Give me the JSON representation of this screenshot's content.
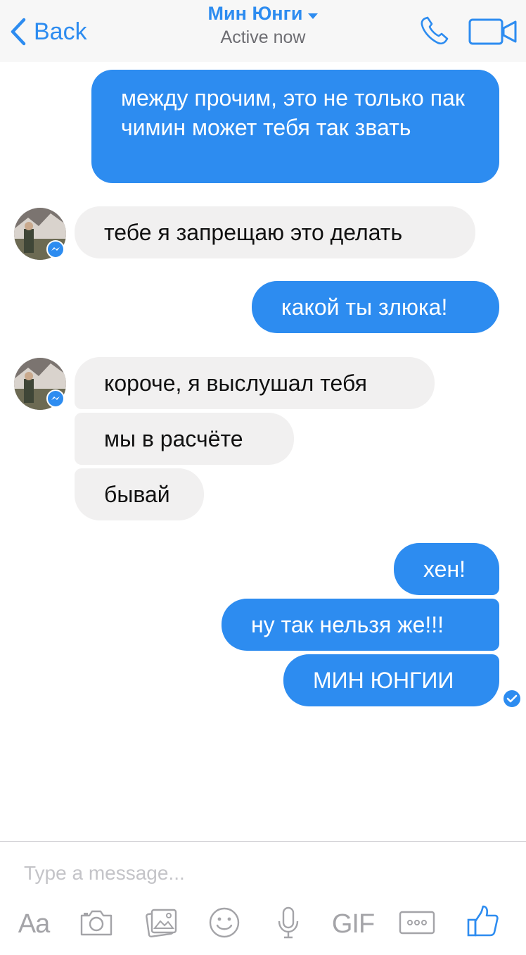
{
  "header": {
    "back_label": "Back",
    "contact_name": "Мин Юнги",
    "status": "Active now"
  },
  "messages": [
    {
      "direction": "outgoing",
      "text": "между прочим, это не только пак чимин может тебя так звать"
    },
    {
      "direction": "incoming",
      "text": "тебе я запрещаю это делать"
    },
    {
      "direction": "outgoing",
      "text": "какой ты злюка!"
    },
    {
      "direction": "incoming",
      "text": "короче, я выслушал тебя"
    },
    {
      "direction": "incoming",
      "text": "мы в расчёте"
    },
    {
      "direction": "incoming",
      "text": "бывай"
    },
    {
      "direction": "outgoing",
      "text": "хен!"
    },
    {
      "direction": "outgoing",
      "text": "ну так нельзя же!!!"
    },
    {
      "direction": "outgoing",
      "text": "МИН ЮНГИИ"
    }
  ],
  "composer": {
    "placeholder": "Type a message...",
    "text_tool_label": "Aa",
    "gif_label": "GIF"
  },
  "icons": {
    "header": [
      "chevron-left-icon",
      "caret-down-icon",
      "phone-icon",
      "video-camera-icon"
    ],
    "toolbar": [
      "camera-icon",
      "photo-gallery-icon",
      "emoji-icon",
      "microphone-icon",
      "more-options-icon",
      "thumbs-up-icon"
    ],
    "avatar_badge": "messenger-bolt-icon",
    "read_receipt": "checkmark-icon"
  },
  "colors": {
    "accent": "#2d8cf0",
    "incoming_bubble": "#f1f0f0",
    "toolbar_icon": "#a4a4a8",
    "header_bg": "#f7f7f7"
  }
}
